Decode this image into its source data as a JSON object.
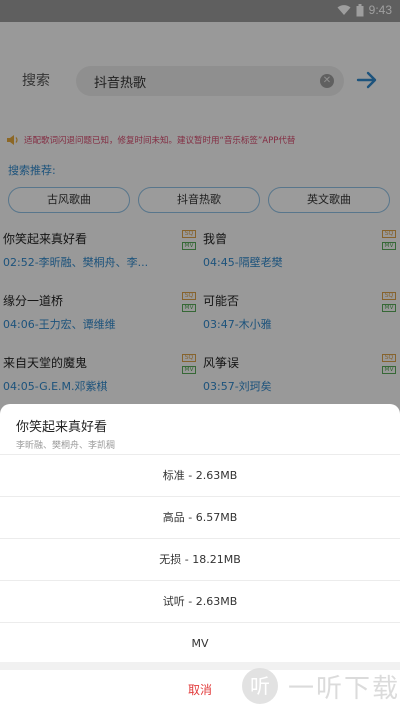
{
  "status_bar": {
    "time": "9:43"
  },
  "search": {
    "label": "搜索",
    "value": "抖音热歌"
  },
  "notice": {
    "text": "适配歌词闪退问题已知，修复时间未知。建议暂时用“音乐标签”APP代替"
  },
  "recommend": {
    "label": "搜索推荐:",
    "chips": [
      "古风歌曲",
      "抖音热歌",
      "英文歌曲"
    ]
  },
  "songs": [
    {
      "title": "你笑起来真好看",
      "meta": "02:52-李昕融、樊桐舟、李...",
      "sq": "SQ",
      "mv": "MV"
    },
    {
      "title": "我曾",
      "meta": "04:45-隔壁老樊",
      "sq": "SQ",
      "mv": "MV"
    },
    {
      "title": "缘分一道桥",
      "meta": "04:06-王力宏、谭维维",
      "sq": "SQ",
      "mv": "MV"
    },
    {
      "title": "可能否",
      "meta": "03:47-木小雅",
      "sq": "SQ",
      "mv": "MV"
    },
    {
      "title": "来自天堂的魔鬼",
      "meta": "04:05-G.E.M.邓紫棋",
      "sq": "SQ",
      "mv": "MV"
    },
    {
      "title": "风筝误",
      "meta": "03:57-刘珂矣",
      "sq": "SQ",
      "mv": "MV"
    }
  ],
  "sheet": {
    "title": "你笑起来真好看",
    "artists": "李昕融、樊桐舟、李凯稠",
    "options": [
      "标准 - 2.63MB",
      "高品 - 6.57MB",
      "无损 - 18.21MB",
      "试听 - 2.63MB",
      "MV"
    ],
    "cancel": "取消"
  },
  "watermark": {
    "logo": "听",
    "text": "一听下载"
  },
  "colors": {
    "accent": "#2f86c8",
    "notice": "#d44a6c",
    "cancel": "#e23c3c"
  }
}
